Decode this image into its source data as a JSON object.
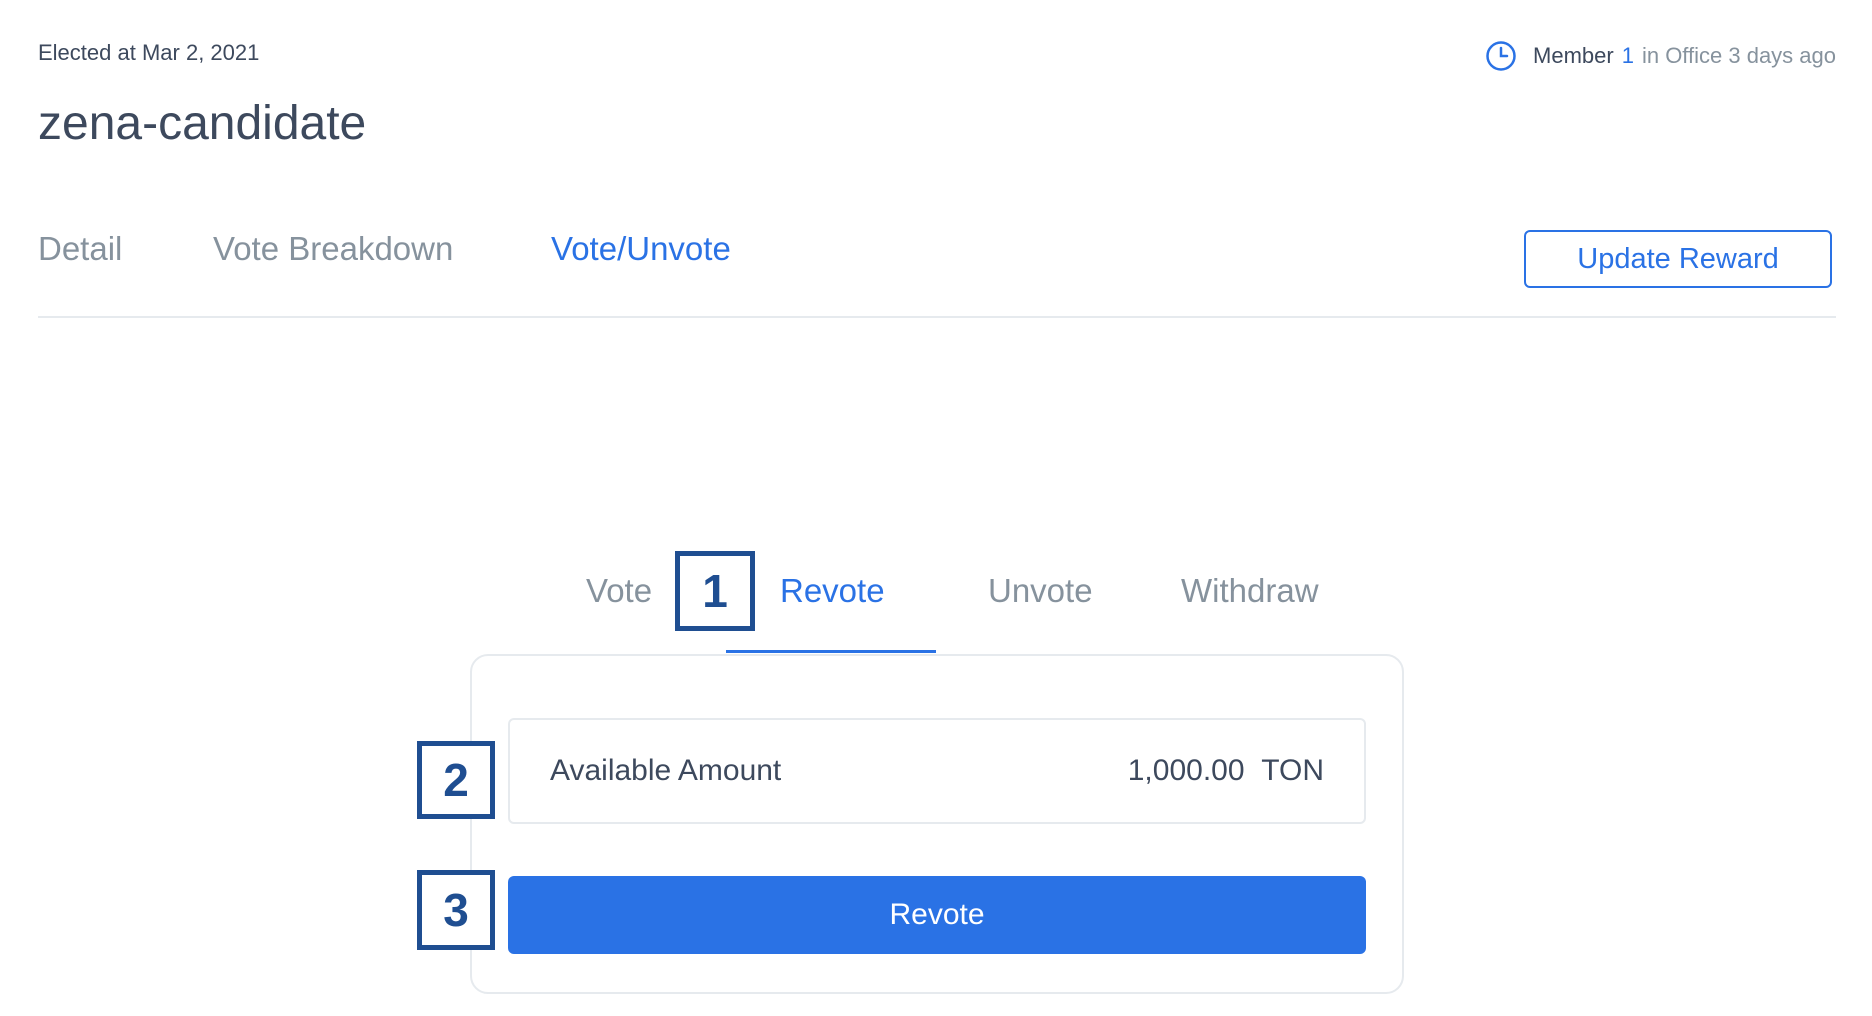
{
  "header": {
    "elected": "Elected at Mar 2, 2021",
    "title": "zena-candidate",
    "member_label": "Member",
    "member_number": "1",
    "member_status": "in Office 3 days ago"
  },
  "top_tabs": [
    {
      "label": "Detail"
    },
    {
      "label": "Vote Breakdown"
    },
    {
      "label": "Vote/Unvote"
    }
  ],
  "update_reward_label": "Update Reward",
  "sub_tabs": [
    {
      "label": "Vote"
    },
    {
      "label": "Revote"
    },
    {
      "label": "Unvote"
    },
    {
      "label": "Withdraw"
    }
  ],
  "card": {
    "available_label": "Available Amount",
    "available_value": "1,000.00",
    "unit": "TON",
    "revote_label": "Revote"
  },
  "callouts": [
    "1",
    "2",
    "3"
  ],
  "colors": {
    "accent": "#2a72e5",
    "callout": "#1f4e91",
    "text": "#3d495d",
    "muted": "#86929d"
  }
}
